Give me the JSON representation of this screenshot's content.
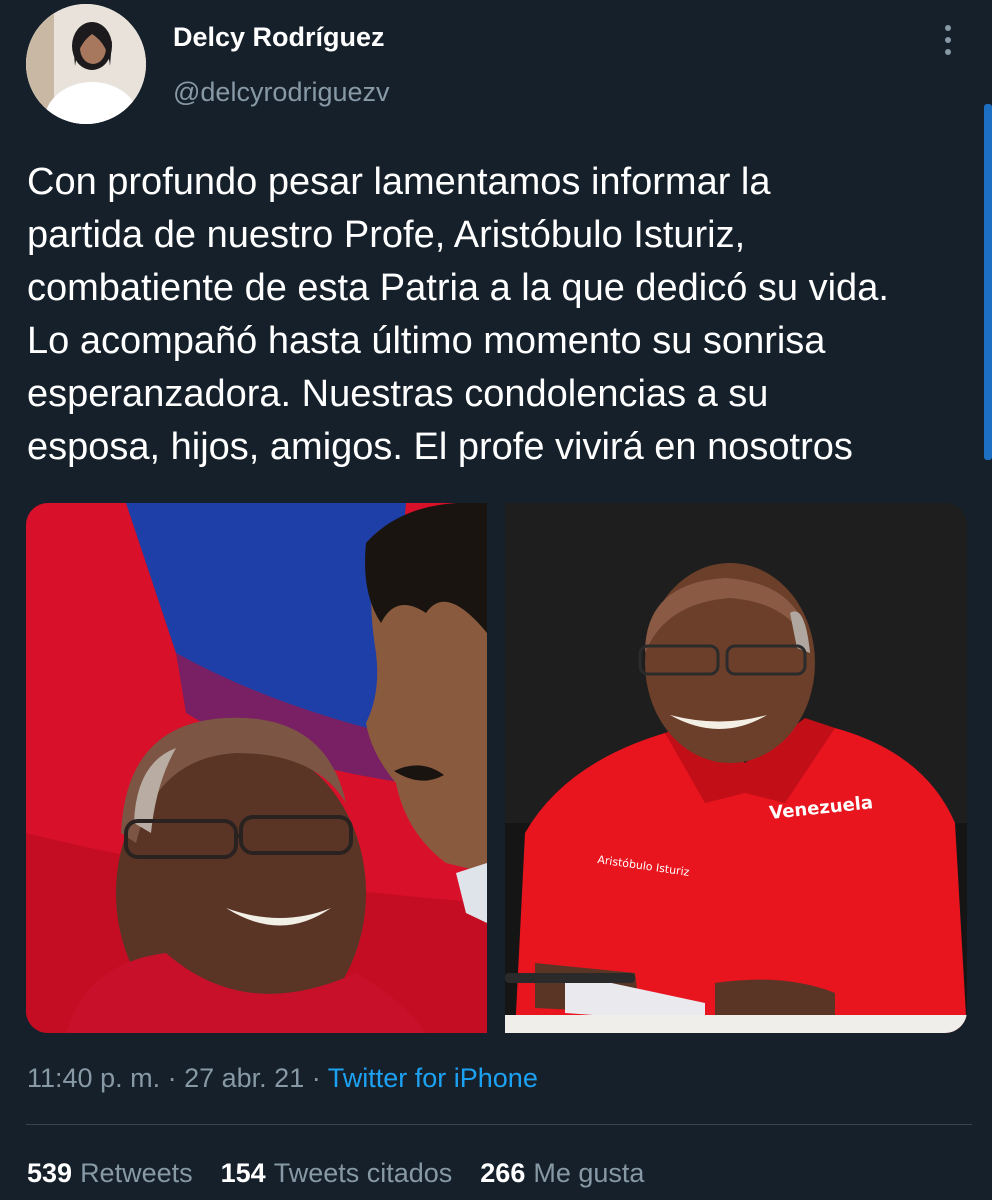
{
  "author": {
    "name": "Delcy Rodríguez",
    "handle": "@delcyrodriguezv"
  },
  "tweet": {
    "text": "Con profundo pesar lamentamos informar la\npartida de nuestro Profe, Aristóbulo Isturiz,\ncombatiente de esta Patria a la que dedicó su vida.\nLo acompañó hasta último momento su sonrisa\nesperanzadora. Nuestras condolencias a su\nesposa, hijos, amigos. El profe vivirá en nosotros",
    "time": "11:40 p. m.",
    "separator": "·",
    "date": "27 abr. 21",
    "source": "Twitter for iPhone"
  },
  "media": {
    "left_photo": "aristobulo-with-maduro-photo",
    "right_photo": "aristobulo-red-shirt-photo",
    "shirt_text": "Aristóbulo Isturiz"
  },
  "stats": {
    "retweets_count": "539",
    "retweets_label": "Retweets",
    "quotes_count": "154",
    "quotes_label": "Tweets citados",
    "likes_count": "266",
    "likes_label": "Me gusta"
  },
  "colors": {
    "background": "#15202b",
    "secondary_text": "#8899a6",
    "link": "#1da1f2",
    "divider": "#38444d"
  }
}
